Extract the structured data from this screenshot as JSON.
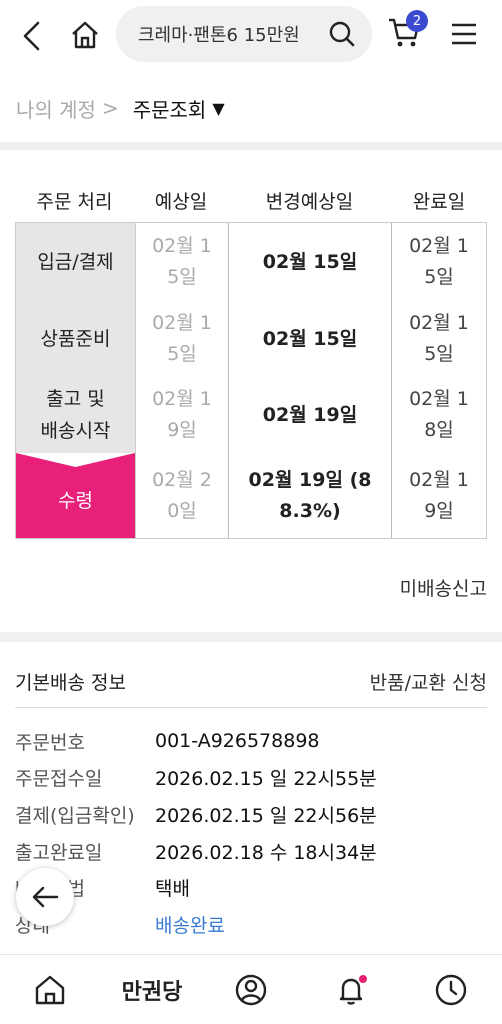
{
  "header": {
    "search_value": "크레마·팬톤6 15만원",
    "cart_count": "2"
  },
  "breadcrumb": {
    "parent": "나의 계정",
    "separator": ">",
    "current": "주문조회",
    "caret": "▼"
  },
  "order_table": {
    "columns": [
      "주문 처리",
      "예상일",
      "변경예상일",
      "완료일"
    ],
    "rows": [
      {
        "status": "입금/결제",
        "expected": "02월 1\n5일",
        "changed": "02월 15일",
        "done": "02월 1\n5일"
      },
      {
        "status": "상품준비",
        "expected": "02월 1\n5일",
        "changed": "02월 15일",
        "done": "02월 1\n5일"
      },
      {
        "status": "출고 및\n배송시작",
        "expected": "02월 1\n9일",
        "changed": "02월 19일",
        "done": "02월 1\n8일"
      },
      {
        "status": "수령",
        "expected": "02월 2\n0일",
        "changed": "02월 19일 (8\n8.3%)",
        "done": "02월 1\n9일"
      }
    ],
    "active_color": "#e8207a"
  },
  "report_link": "미배송신고",
  "delivery_info": {
    "title": "기본배송 정보",
    "action": "반품/교환 신청",
    "rows": [
      {
        "key": "주문번호",
        "value": "001-A926578898"
      },
      {
        "key": "주문접수일",
        "value": "2026.02.15 일 22시55분"
      },
      {
        "key": "결제(입금확인)",
        "value": "2026.02.15 일 22시56분"
      },
      {
        "key": "출고완료일",
        "value": "2026.02.18 수 18시34분"
      },
      {
        "key": "배송방법",
        "value": "택배"
      },
      {
        "key": "상태",
        "value": "배송완료"
      }
    ]
  },
  "bottom_nav": {
    "brand": "만권당"
  }
}
